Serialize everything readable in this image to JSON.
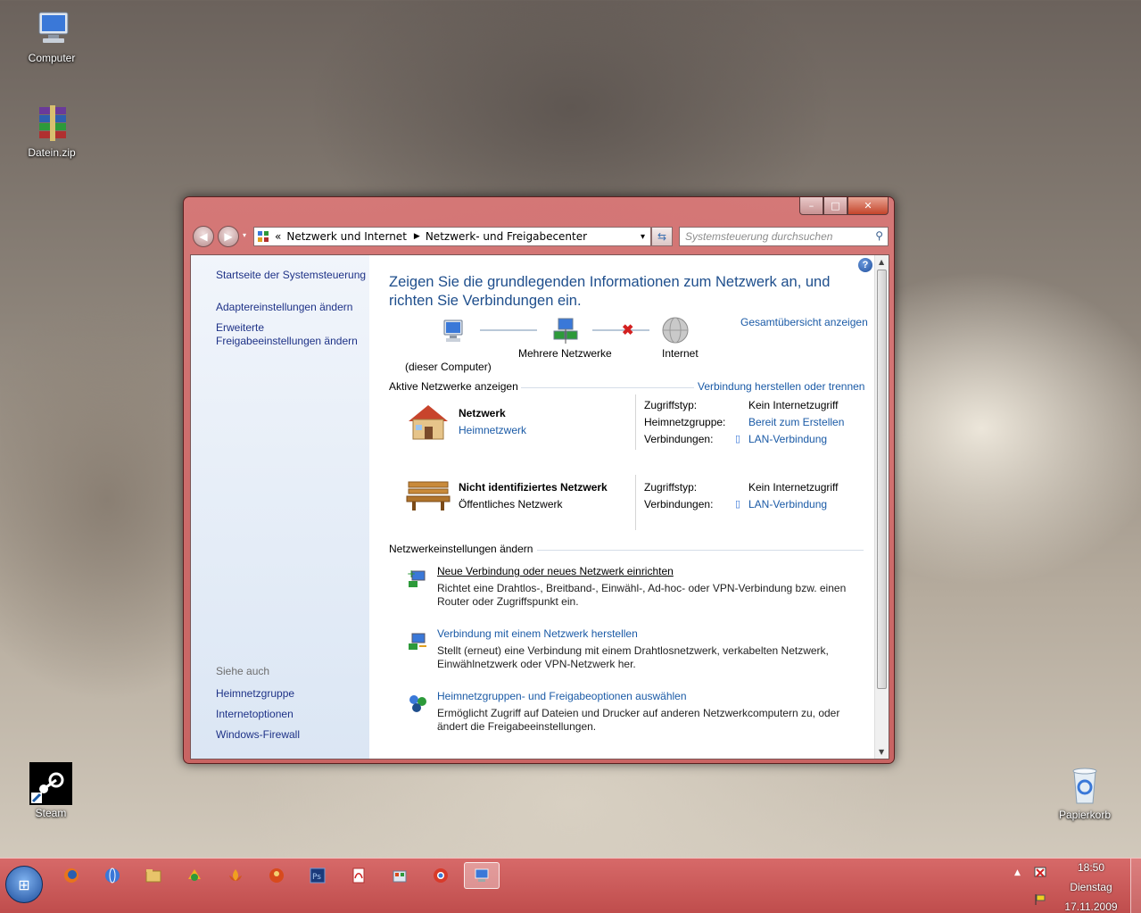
{
  "desktop": {
    "icons": [
      {
        "label": "Computer",
        "icon": "computer-icon"
      },
      {
        "label": "Datein.zip",
        "icon": "winrar-archive-icon"
      },
      {
        "label": "Steam",
        "icon": "steam-icon"
      },
      {
        "label": "Papierkorb",
        "icon": "recycle-bin-icon"
      }
    ]
  },
  "window": {
    "caption_buttons": {
      "minimize": "–",
      "maximize": "□",
      "close": "✕"
    },
    "address": {
      "prefix": "«",
      "crumbs": [
        "Netzwerk und Internet",
        "Netzwerk- und Freigabecenter"
      ],
      "separator": "▶",
      "dropdown": "▾"
    },
    "search": {
      "placeholder": "Systemsteuerung durchsuchen"
    },
    "sidebar": {
      "home": "Startseite der Systemsteuerung",
      "links": [
        "Adaptereinstellungen ändern",
        "Erweiterte Freigabeeinstellungen ändern"
      ],
      "see_also_title": "Siehe auch",
      "see_also": [
        "Heimnetzgruppe",
        "Internetoptionen",
        "Windows-Firewall"
      ]
    },
    "main": {
      "heading": "Zeigen Sie die grundlegenden Informationen zum Netzwerk an, und richten Sie Verbindungen ein.",
      "map": {
        "overview_link": "Gesamtübersicht anzeigen",
        "nodes": [
          "(dieser Computer)",
          "Mehrere Netzwerke",
          "Internet"
        ]
      },
      "active_networks": {
        "title": "Aktive Netzwerke anzeigen",
        "action_link": "Verbindung herstellen oder trennen",
        "networks": [
          {
            "name": "Netzwerk",
            "type": "Heimnetzwerk",
            "type_is_link": true,
            "icon": "house-icon",
            "props": [
              {
                "label": "Zugriffstyp:",
                "value": "Kein Internetzugriff",
                "link": false
              },
              {
                "label": "Heimnetzgruppe:",
                "value": "Bereit zum Erstellen",
                "link": true
              },
              {
                "label": "Verbindungen:",
                "value": "LAN-Verbindung",
                "link": true
              }
            ]
          },
          {
            "name": "Nicht identifiziertes Netzwerk",
            "type": "Öffentliches Netzwerk",
            "type_is_link": false,
            "icon": "park-bench-icon",
            "props": [
              {
                "label": "Zugriffstyp:",
                "value": "Kein Internetzugriff",
                "link": false
              },
              {
                "label": "Verbindungen:",
                "value": "LAN-Verbindung",
                "link": true
              }
            ]
          }
        ]
      },
      "change_settings": {
        "title": "Netzwerkeinstellungen ändern",
        "tasks": [
          {
            "title": "Neue Verbindung oder neues Netzwerk einrichten",
            "desc": "Richtet eine Drahtlos-, Breitband-, Einwähl-, Ad-hoc- oder VPN-Verbindung bzw. einen Router oder Zugriffspunkt ein.",
            "icon": "new-connection-icon"
          },
          {
            "title": "Verbindung mit einem Netzwerk herstellen",
            "desc": "Stellt (erneut) eine Verbindung mit einem Drahtlosnetzwerk, verkabelten Netzwerk, Einwählnetzwerk oder VPN-Netzwerk her.",
            "icon": "connect-network-icon"
          },
          {
            "title": "Heimnetzgruppen- und Freigabeoptionen auswählen",
            "desc": "Ermöglicht Zugriff auf Dateien und Drucker auf anderen Netzwerkcomputern zu, oder ändert die Freigabeeinstellungen.",
            "icon": "homegroup-icon"
          }
        ]
      }
    }
  },
  "taskbar": {
    "start_icon": "windows-orb-icon",
    "apps": [
      "firefox-icon",
      "network-globe-icon",
      "explorer-folder-icon",
      "winamp-icon",
      "lotus-icon",
      "avatar-app-icon",
      "photoshop-icon",
      "pdf-reader-icon",
      "control-panel-icon",
      "chrome-like-icon",
      "network-center-icon"
    ],
    "clock": {
      "time": "18:50",
      "day": "Dienstag",
      "date": "17.11.2009"
    }
  },
  "colors": {
    "link": "#1a5aa6",
    "heading": "#1e4e8c",
    "window_frame": "#d06a6a"
  }
}
